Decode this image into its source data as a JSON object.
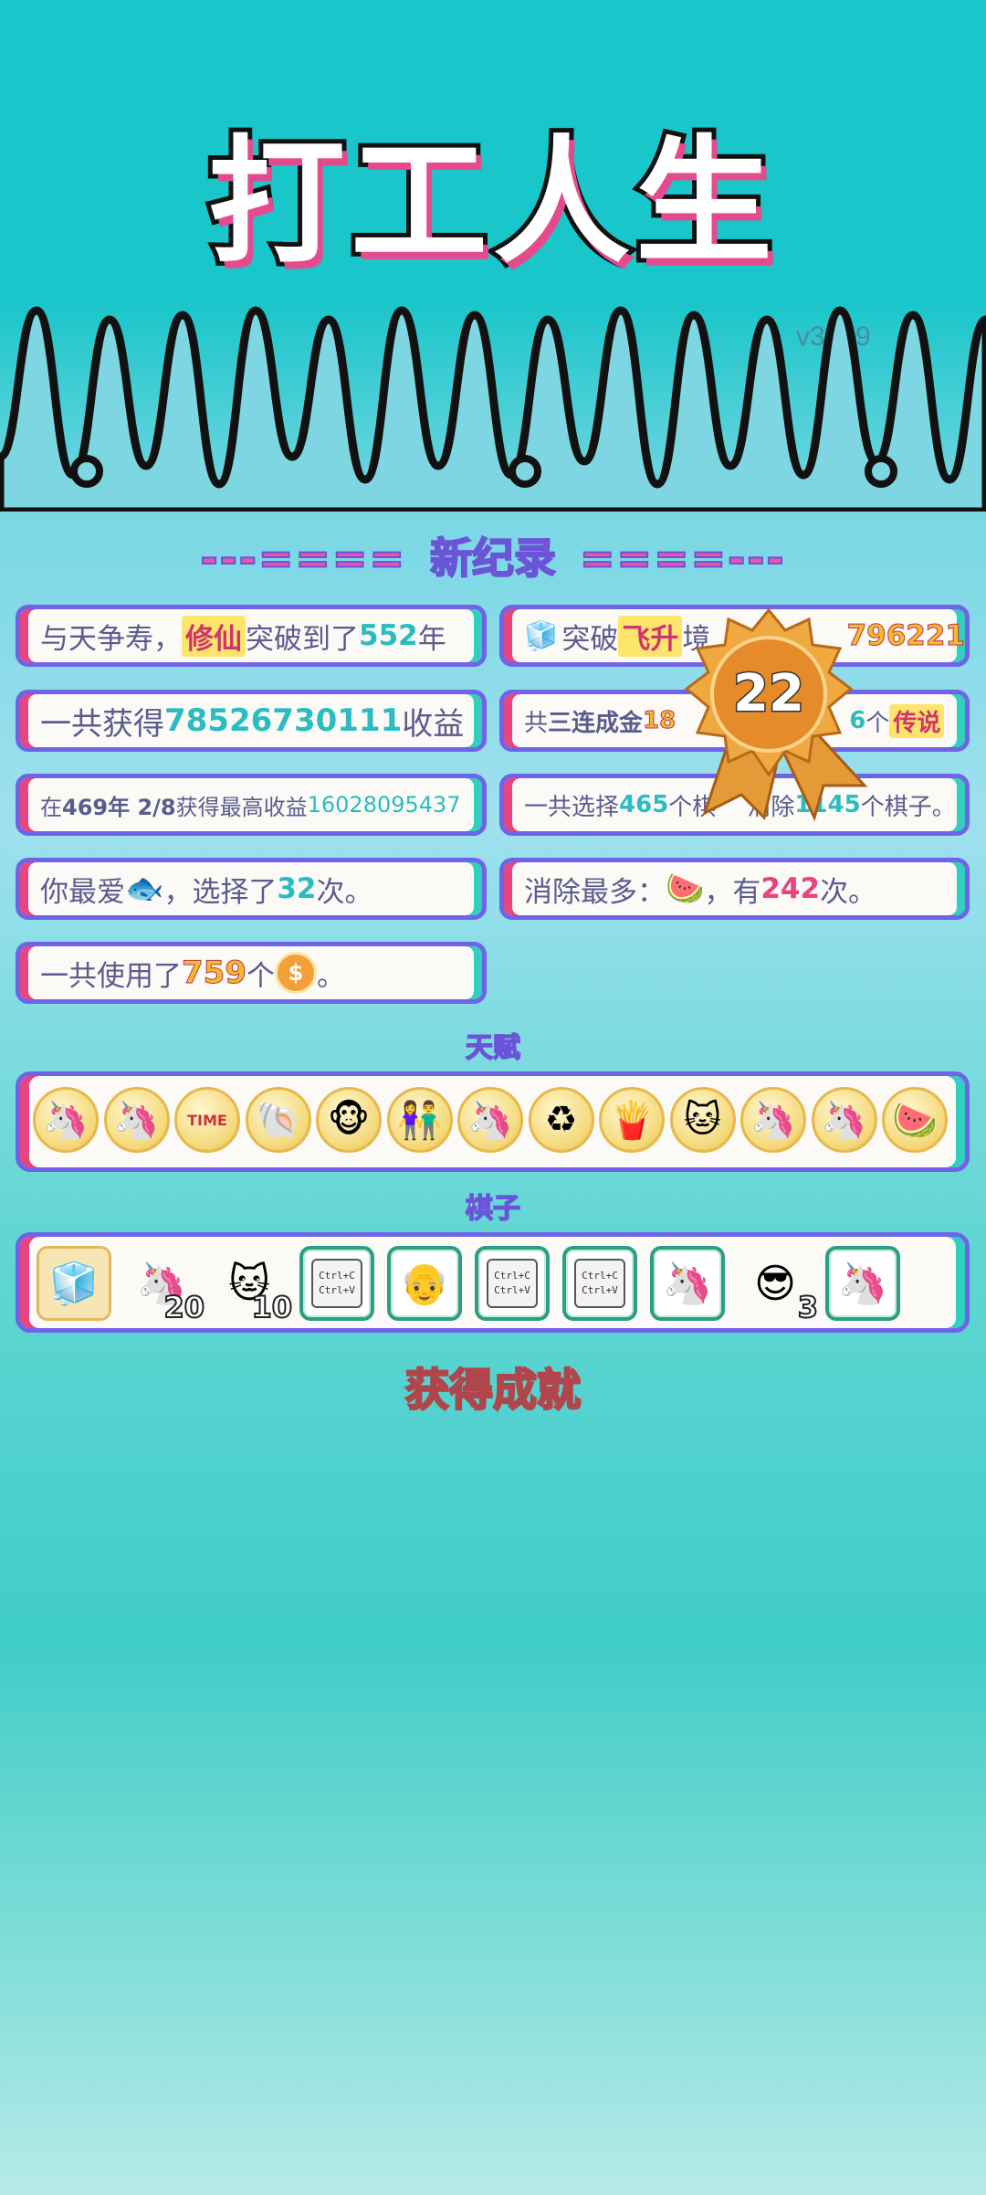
{
  "header": {
    "title": "打工人生",
    "version": "v3.8.9"
  },
  "records": {
    "heading_dashes_left": "---====",
    "heading": "新纪录",
    "heading_dashes_right": "====---",
    "rows": {
      "longevity": {
        "prefix": "与天争寿，",
        "realm": "修仙",
        "mid": "突破到了",
        "years": "552",
        "suffix": "年"
      },
      "ascend": {
        "prefix": "突破",
        "realm": "飞升",
        "mid": "境",
        "value": "796221"
      },
      "total_income": {
        "prefix": "一共获得",
        "amount": "78526730111",
        "suffix": "收益"
      },
      "combo": {
        "prefix": "共",
        "label": "三连成金",
        "count": "18",
        "count2": "6",
        "mid": "个",
        "rank": "传说"
      },
      "best_income": {
        "prefix": "在 ",
        "time": "469年 2/8",
        "mid": " 获得最高收益",
        "amount": "16028095437"
      },
      "pieces": {
        "prefix": "一共选择",
        "chosen": "465",
        "mid": "个棋",
        "mid2": "消除",
        "removed": "1145",
        "suffix": "个棋子。"
      },
      "favorite": {
        "prefix": "你最爱",
        "mid": "，选择了",
        "count": "32",
        "suffix": "次。"
      },
      "most_removed": {
        "prefix": "消除最多：",
        "mid": "，有",
        "count": "242",
        "suffix": "次。"
      },
      "coins_used": {
        "prefix": "一共使用了",
        "count": "759",
        "mid": "个",
        "suffix": "。"
      }
    }
  },
  "medal": {
    "number": "22"
  },
  "talents": {
    "heading": "天赋",
    "items": [
      "🦄",
      "🦄",
      "TIME",
      "🐚",
      "🐵",
      "👫",
      "🦄",
      "♻",
      "🍟",
      "🐱",
      "🦄",
      "🦄",
      "🍉"
    ]
  },
  "pieces": {
    "heading": "棋子",
    "items": [
      {
        "icon": "🧊",
        "style": "fridge",
        "count": ""
      },
      {
        "icon": "🦄",
        "style": "plain",
        "count": "20"
      },
      {
        "icon": "🐱",
        "style": "plain",
        "count": "10"
      },
      {
        "icon": "ctrl",
        "style": "boxed",
        "count": ""
      },
      {
        "icon": "👴",
        "style": "boxed",
        "count": ""
      },
      {
        "icon": "ctrl",
        "style": "boxed",
        "count": ""
      },
      {
        "icon": "ctrl",
        "style": "boxed",
        "count": ""
      },
      {
        "icon": "🦄",
        "style": "boxed",
        "count": ""
      },
      {
        "icon": "😎",
        "style": "plain",
        "count": "3"
      },
      {
        "icon": "🦄",
        "style": "boxed",
        "count": ""
      }
    ],
    "ctrl_line1": "Ctrl+C",
    "ctrl_line2": "Ctrl+V"
  },
  "achievements": {
    "heading": "获得成就"
  },
  "colors": {
    "accent_purple": "#6f63e6",
    "accent_pink": "#e8447f",
    "accent_teal": "#31cfc0",
    "bg_top": "#19c6c9"
  }
}
